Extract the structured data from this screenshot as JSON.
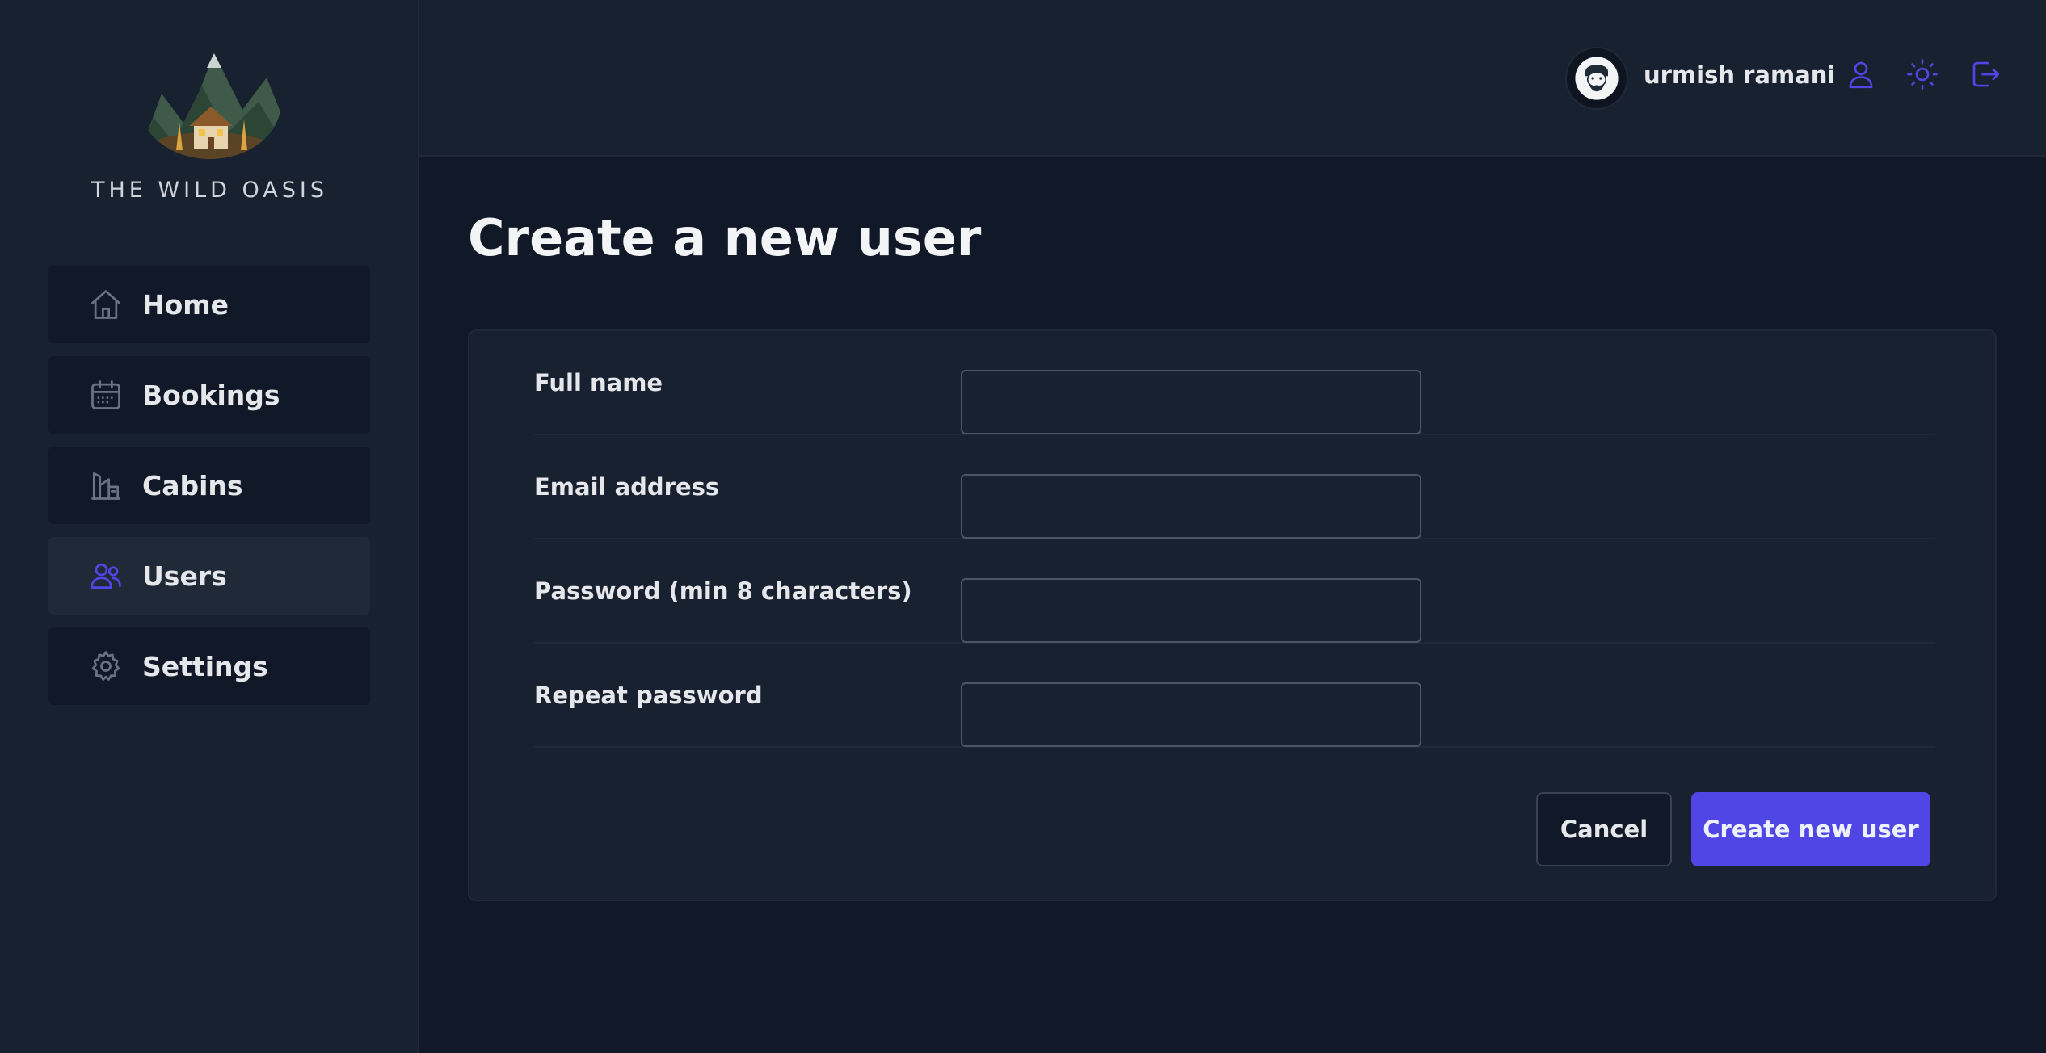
{
  "brand": {
    "name": "THE WILD OASIS"
  },
  "nav": {
    "items": [
      {
        "label": "Home",
        "icon": "home-icon",
        "active": false
      },
      {
        "label": "Bookings",
        "icon": "calendar-icon",
        "active": false
      },
      {
        "label": "Cabins",
        "icon": "building-icon",
        "active": false
      },
      {
        "label": "Users",
        "icon": "users-icon",
        "active": true
      },
      {
        "label": "Settings",
        "icon": "gear-icon",
        "active": false
      }
    ]
  },
  "header": {
    "username": "urmish ramani",
    "buttons": [
      "user-icon",
      "sun-icon",
      "logout-icon"
    ]
  },
  "main": {
    "title": "Create a new user"
  },
  "form": {
    "fields": [
      {
        "label": "Full name",
        "value": ""
      },
      {
        "label": "Email address",
        "value": ""
      },
      {
        "label": "Password (min 8 characters)",
        "value": ""
      },
      {
        "label": "Repeat password",
        "value": ""
      }
    ],
    "cancel_label": "Cancel",
    "submit_label": "Create new user"
  },
  "colors": {
    "accent": "#4f46e5",
    "sidebar_bg": "#18212f",
    "page_bg": "#111827",
    "nav_item_bg": "#111827",
    "nav_active_bg": "#1f2937",
    "icon_inactive": "#6b7280",
    "icon_accent": "#4f46e5"
  }
}
